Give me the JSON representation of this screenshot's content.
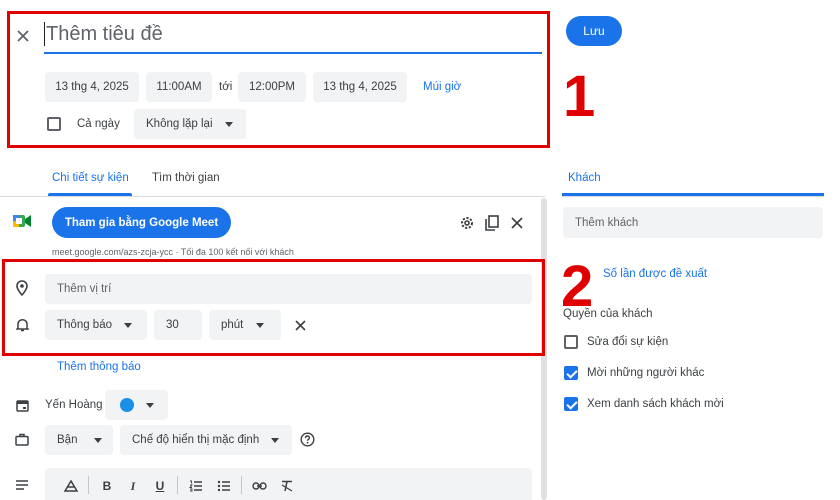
{
  "header": {
    "title_placeholder": "Thêm tiêu đề",
    "save_label": "Lưu"
  },
  "datetime": {
    "start_date": "13 thg 4, 2025",
    "start_time": "11:00AM",
    "to_label": "tới",
    "end_time": "12:00PM",
    "end_date": "13 thg 4, 2025",
    "timezone_link": "Múi giờ",
    "all_day_label": "Cả ngày",
    "all_day_checked": false,
    "repeat_value": "Không lặp lại"
  },
  "tabs": {
    "details": "Chi tiết sự kiện",
    "find_time": "Tìm thời gian",
    "guests": "Khách"
  },
  "meet": {
    "join_label": "Tham gia bằng Google Meet",
    "info": "meet.google.com/azs-zcja-ycc · Tối đa 100 kết nối với khách"
  },
  "location": {
    "placeholder": "Thêm vị trí"
  },
  "notification": {
    "type": "Thông báo",
    "amount": "30",
    "unit": "phút",
    "add_label": "Thêm thông báo"
  },
  "calendar": {
    "owner": "Yến Hoàng",
    "color": "#1a8fe8"
  },
  "availability": {
    "busy": "Bận",
    "visibility": "Chế độ hiển thị mặc định"
  },
  "guests_panel": {
    "add_placeholder": "Thêm khách",
    "suggested_link": "Số lần được đề xuất",
    "permissions_title": "Quyền của khách",
    "permissions": [
      {
        "label": "Sửa đổi sự kiện",
        "checked": false
      },
      {
        "label": "Mời những người khác",
        "checked": true
      },
      {
        "label": "Xem danh sách khách mời",
        "checked": true
      }
    ]
  },
  "annotations": {
    "one": "1",
    "two": "2"
  },
  "colors": {
    "accent": "#1a73e8",
    "annotation": "#e00000",
    "chip_bg": "#f1f3f4"
  }
}
